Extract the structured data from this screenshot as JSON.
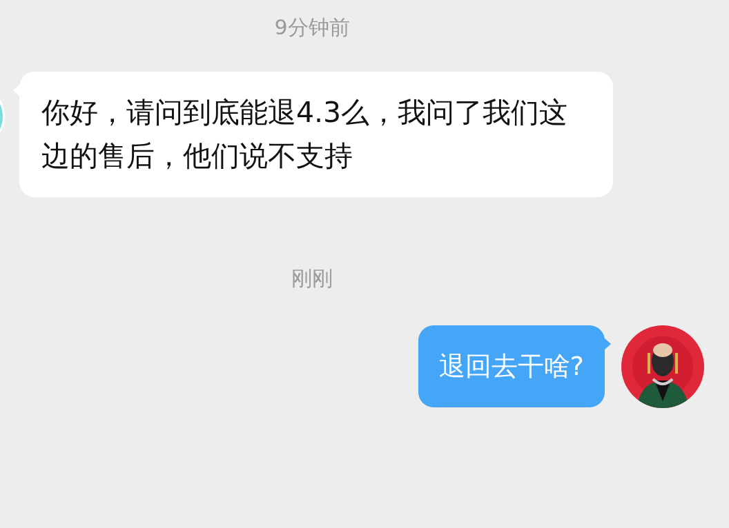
{
  "messages": [
    {
      "kind": "time",
      "text": "9分钟前"
    },
    {
      "kind": "received",
      "text": "你好，请问到底能退4.3么，我问了我们这边的售后，他们说不支持"
    },
    {
      "kind": "time",
      "text": "刚刚"
    },
    {
      "kind": "sent",
      "text": "退回去干啥?"
    }
  ]
}
